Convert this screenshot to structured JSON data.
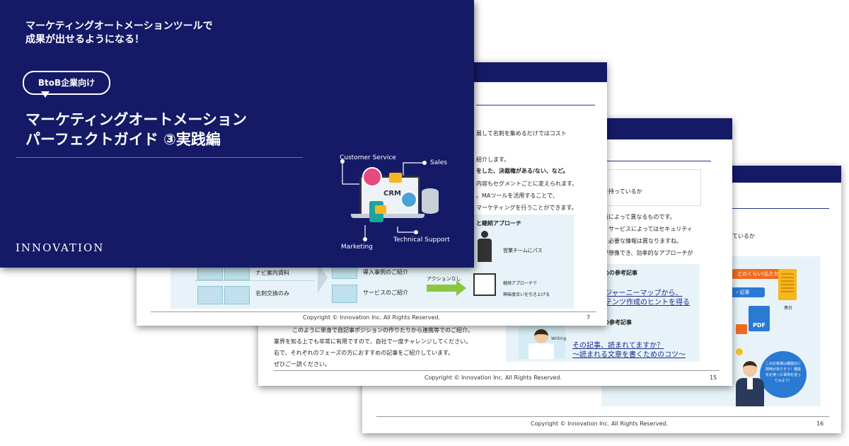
{
  "cover": {
    "subtitle_line1": "マーケティングオートメーションツールで",
    "subtitle_line2": "成果が出せるようになる！",
    "badge": "BtoB企業向け",
    "title_line1": "マーケティングオートメーション",
    "title_line2": "パーフェクトガイド ③実践編",
    "logo": "INNOVATION",
    "diagram": {
      "customer_service": "Customer Service",
      "sales": "Sales",
      "crm": "CRM",
      "marketing": "Marketing",
      "technical_support": "Technical Support"
    }
  },
  "page7": {
    "lines": [
      "展して名刺を集めるだけではコスト",
      "紹介します。",
      "をした、決裁権がある/ない、など。",
      "内容もセグメントごとに変えられます。",
      "。MAツールを活用することで、",
      "マーケティングを行うことができます。"
    ],
    "approach_title": "と継続アプローチ",
    "pass_label": "営業チームにパス",
    "left_row1": "ナビ案内資料",
    "left_row2": "名刺交換のみ",
    "mid_row1": "導入事例のご紹介",
    "mid_row2": "サービスのご紹介",
    "arrow_label": "アクションなし",
    "continue_label1": "継続アプローチで",
    "continue_label2": "興味度合いを引き上げる",
    "footer": "Copyright © Innovation Inc. All Rights Reserved.",
    "page_number": "7"
  },
  "page15": {
    "box_line": "を持っているか",
    "lines": [
      "階によって異なるものです。",
      "、サービスによってはセキュリティ",
      "、必要な情報は異なりますね。",
      "が想像でき、効率的なアプローチが"
    ],
    "ref1_title": "めの参考記事",
    "ref1_link1": "ジャーニーマップから、",
    "ref1_link2": "テンツ作成のヒントを得る",
    "ref2_title": "の参考記事",
    "ref2_link1": "その記事、読まれてますか？",
    "ref2_link2": "～読まれる文章を書くためのコツ～",
    "writing_label": "Writing",
    "bottom_line1": "このように単身で自記事ポジションの作りたりから連携等でのご紹介。",
    "bottom_line2": "業界を知る上でも非常に有用ですので、自社で一度チャレンジしてください。",
    "bottom_line3": "右で、それぞれのフェーズの方におすすめの記事をご紹介しています。",
    "bottom_line4": "ぜひご一読ください。",
    "footer": "Copyright © Innovation Inc. All Rights Reserved.",
    "page_number": "15"
  },
  "page16": {
    "box_line": "ているか",
    "bubble_top": "どのくらい(払たか)",
    "bubble_mid": "・記事",
    "company_label": "貴社",
    "pdf_label": "PDF",
    "speech": "このお客様は機能比に興味がありそう！機能化を使った事例を送ってみよう！",
    "footer": "Copyright © Innovation Inc. All Rights Reserved.",
    "page_number": "16"
  },
  "colors": {
    "navy": "#151a66",
    "pale_blue": "#e7f3f8",
    "green_arrow": "#8cc63f",
    "blue_accent": "#2a7ad4"
  }
}
